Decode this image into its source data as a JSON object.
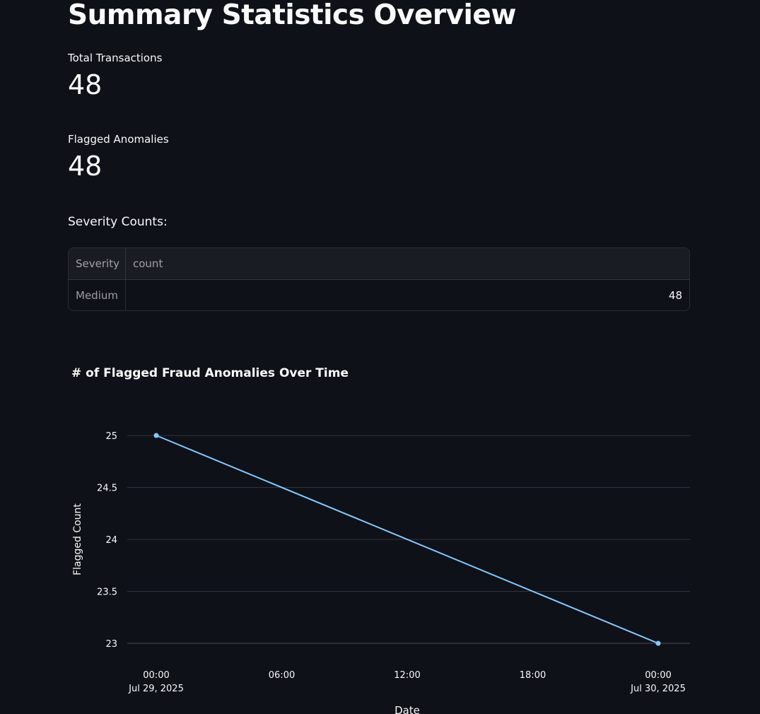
{
  "page_title": "Summary Statistics Overview",
  "metrics": [
    {
      "label": "Total Transactions",
      "value": "48"
    },
    {
      "label": "Flagged Anomalies",
      "value": "48"
    }
  ],
  "severity_section_label": "Severity Counts:",
  "severity_table": {
    "index_header": "Severity",
    "columns": [
      "count"
    ],
    "rows": [
      {
        "index": "Medium",
        "count": "48"
      }
    ]
  },
  "colors": {
    "background": "#0e1117",
    "text": "#fafafa",
    "line": "#83c9ff",
    "grid": "#31333f"
  },
  "chart_data": {
    "type": "line",
    "title": "# of Flagged Fraud Anomalies Over Time",
    "xlabel": "Date",
    "ylabel": "Flagged Count",
    "x": [
      "2025-07-29T00:00",
      "2025-07-30T00:00"
    ],
    "xlim": [
      "2025-07-29T00:00",
      "2025-07-30T00:00"
    ],
    "x_tick_labels": [
      [
        "00:00",
        "Jul 29, 2025"
      ],
      [
        "06:00",
        ""
      ],
      [
        "12:00",
        ""
      ],
      [
        "18:00",
        ""
      ],
      [
        "00:00",
        "Jul 30, 2025"
      ]
    ],
    "series": [
      {
        "values": [
          25,
          23
        ]
      }
    ],
    "y_ticks": [
      23,
      23.5,
      24,
      24.5,
      25
    ],
    "y_tick_labels": [
      "23",
      "23.5",
      "24",
      "24.5",
      "25"
    ],
    "ylim": [
      23,
      25
    ],
    "grid": true,
    "markers": true
  }
}
